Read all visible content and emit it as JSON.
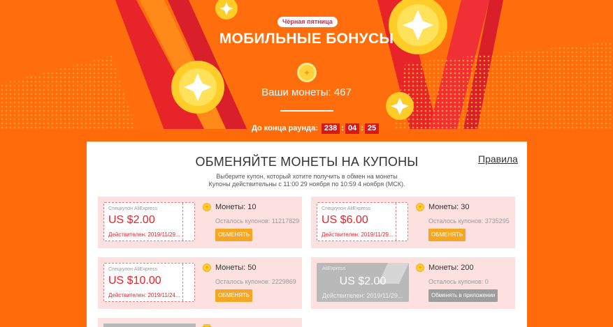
{
  "hero": {
    "badge": "Чёрная пятница",
    "title": "МОБИЛЬНЫЕ БОНУСЫ",
    "coins_line": "Ваши монеты: 467",
    "timer_label": "До конца раунда:",
    "timer": {
      "hours": "238",
      "minutes": "04",
      "seconds": "25"
    }
  },
  "panel": {
    "title": "ОБМЕНЯЙТЕ МОНЕТЫ НА КУПОНЫ",
    "rules": "Правила",
    "sub1": "Выберите купон, который хотите получить в обмен на монеты",
    "sub2": "Купоны действительны с 11:00 29 ноября по 10:59 4 ноября (МСК)."
  },
  "cards": [
    {
      "kind": "Спецкупон AliExpress",
      "amount": "US $2.00",
      "valid": "Действителен: 2019/11/29...",
      "cost": "Монеты: 10",
      "left": "Осталось купонов: 11217829",
      "button": "ОБМЕНЯТЬ"
    },
    {
      "kind": "Спецкупон AliExpress",
      "amount": "US $6.00",
      "valid": "Действителен: 2019/11/29...",
      "cost": "Монеты: 30",
      "left": "Осталось купонов: 3735295",
      "button": "ОБМЕНЯТЬ"
    },
    {
      "kind": "Спецкупон AliExpress",
      "amount": "US $10.00",
      "valid": "Действителен: 2019/11/24...",
      "cost": "Монеты: 50",
      "left": "Осталось купонов: 2229869",
      "button": "ОБМЕНЯТЬ"
    },
    {
      "kind": "AliExpress",
      "amount": "US $2.00",
      "valid": "Действителен: 2019/11/29...",
      "cost": "Монеты: 200",
      "left": "Осталось купонов: 0",
      "button": "Обменять в приложении"
    }
  ],
  "colors": {
    "hero_bg": "#ff6d0c",
    "accent_red": "#e8222a",
    "button_orange": "#f5a623",
    "card_bg": "#fde1e1",
    "coin_yellow": "#ffd23a"
  },
  "icons": {
    "coin": "star-coin-icon"
  }
}
